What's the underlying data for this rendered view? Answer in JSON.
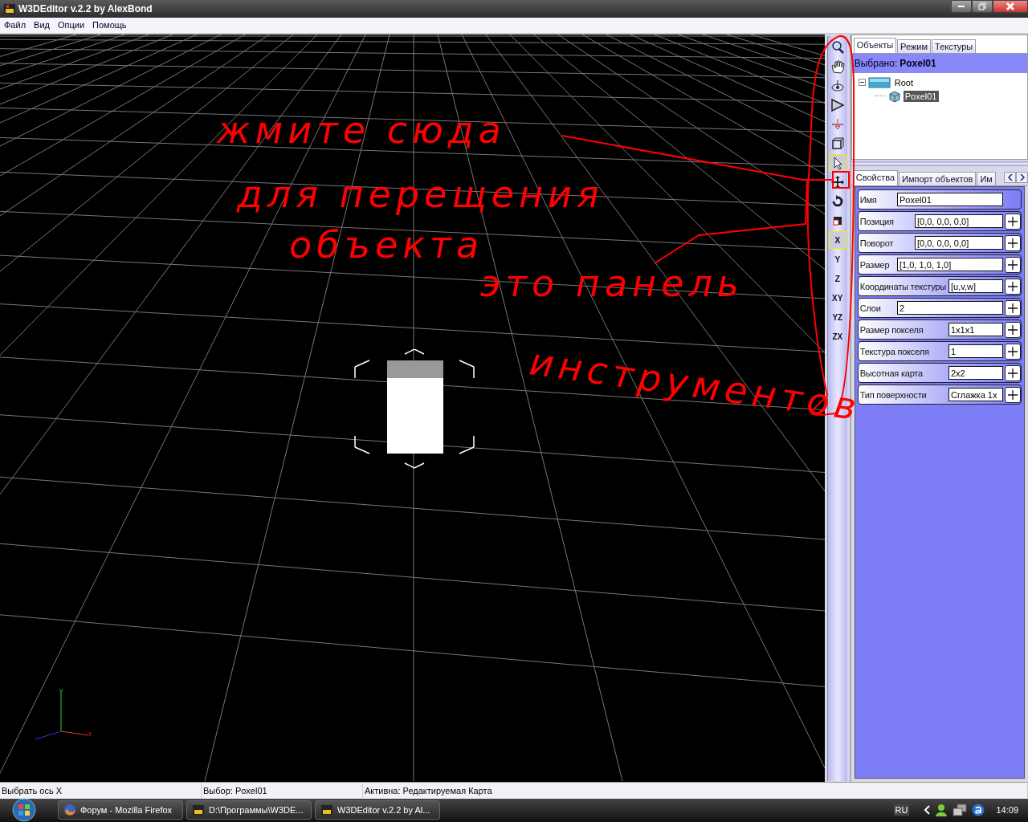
{
  "window": {
    "title": "W3DEditor v.2.2 by AlexBond"
  },
  "menu": [
    "Файл",
    "Вид",
    "Опции",
    "Помощь"
  ],
  "viewport": {
    "axes": [
      "y",
      "x"
    ]
  },
  "annotation": {
    "lines": [
      "жмите сюда",
      "для перещения",
      "объекта",
      "это панель",
      "инструментов"
    ]
  },
  "toolbar": [
    {
      "kind": "icon",
      "selected": false
    },
    {
      "kind": "icon",
      "selected": false
    },
    {
      "kind": "icon",
      "selected": false
    },
    {
      "kind": "icon",
      "selected": false
    },
    {
      "kind": "icon",
      "selected": false
    },
    {
      "kind": "icon",
      "selected": false
    },
    {
      "kind": "icon",
      "selected": true
    },
    {
      "kind": "icon",
      "selected": false
    },
    {
      "kind": "icon",
      "selected": false
    },
    {
      "kind": "icon",
      "selected": false
    },
    {
      "kind": "text",
      "label": "X",
      "selected": true
    },
    {
      "kind": "text",
      "label": "Y",
      "selected": false
    },
    {
      "kind": "text",
      "label": "Z",
      "selected": false
    },
    {
      "kind": "text",
      "label": "XY",
      "selected": false
    },
    {
      "kind": "text",
      "label": "YZ",
      "selected": false
    },
    {
      "kind": "text",
      "label": "ZX",
      "selected": false
    }
  ],
  "top_tabs": [
    {
      "label": "Объекты",
      "selected": true
    },
    {
      "label": "Режим",
      "selected": false
    },
    {
      "label": "Текстуры",
      "selected": false
    }
  ],
  "selection": {
    "label": "Выбрано:",
    "value": "Poxel01"
  },
  "tree": [
    {
      "label": "Root",
      "expanded": true,
      "selected": false,
      "children": [
        {
          "label": "Poxel01",
          "selected": true
        }
      ]
    }
  ],
  "bottom_tabs": [
    {
      "label": "Свойства",
      "selected": true
    },
    {
      "label": "Импорт объектов",
      "selected": false
    },
    {
      "label": "Им",
      "selected": false
    }
  ],
  "properties": [
    {
      "label": "Имя",
      "value": "Poxel01",
      "expandable": false
    },
    {
      "label": "Позиция",
      "value": "[0,0, 0,0, 0,0]",
      "expandable": true
    },
    {
      "label": "Поворот",
      "value": "[0,0, 0,0, 0,0]",
      "expandable": true
    },
    {
      "label": "Размер",
      "value": "[1,0, 1,0, 1,0]",
      "expandable": true
    },
    {
      "label": "Координаты текстуры",
      "value": "[u,v,w]",
      "expandable": true
    },
    {
      "label": "Слои",
      "value": "2",
      "expandable": true
    },
    {
      "label": "Размер покселя",
      "value": "1x1x1",
      "expandable": true
    },
    {
      "label": "Текстура покселя",
      "value": "1",
      "expandable": true
    },
    {
      "label": "Высотная карта",
      "value": "2x2",
      "expandable": true
    },
    {
      "label": "Тип поверхности",
      "value": "Сглажка 1x",
      "expandable": true
    }
  ],
  "status_bar": [
    "Выбрать ось X",
    "Выбор: Poxel01",
    "Активна: Редактируемая Карта"
  ],
  "taskbar": {
    "tasks": [
      {
        "label": "Форум - Mozilla Firefox",
        "kind": "browser"
      },
      {
        "label": "D:\\Программы\\W3DE...",
        "kind": "app"
      },
      {
        "label": "W3DEditor v.2.2 by Al...",
        "kind": "app"
      }
    ],
    "language": "RU",
    "clock": "14:09"
  }
}
